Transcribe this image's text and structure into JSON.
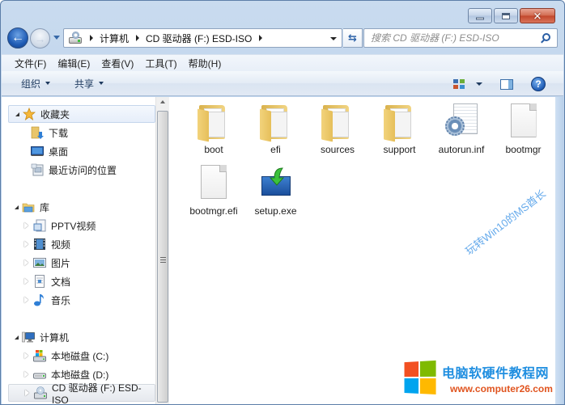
{
  "window": {
    "caption_buttons": {
      "minimize": "minimize",
      "maximize": "maximize",
      "close": "✕"
    }
  },
  "nav": {
    "back_glyph": "←",
    "forward_glyph": "→",
    "refresh_glyph": "⇆",
    "breadcrumb": [
      "计算机",
      "CD 驱动器 (F:) ESD-ISO"
    ],
    "search_placeholder": "搜索 CD 驱动器 (F:) ESD-ISO",
    "search_value": ""
  },
  "menubar": {
    "items": [
      "文件(F)",
      "编辑(E)",
      "查看(V)",
      "工具(T)",
      "帮助(H)"
    ]
  },
  "commandbar": {
    "organize_label": "组织",
    "share_label": "共享",
    "help_glyph": "?"
  },
  "sidebar": {
    "favorites": {
      "label": "收藏夹",
      "items": [
        {
          "label": "下载",
          "icon": "downloads-icon"
        },
        {
          "label": "桌面",
          "icon": "desktop-icon"
        },
        {
          "label": "最近访问的位置",
          "icon": "recent-places-icon"
        }
      ]
    },
    "libraries": {
      "label": "库",
      "items": [
        {
          "label": "PPTV视频",
          "icon": "pptv-library-icon"
        },
        {
          "label": "视频",
          "icon": "videos-icon"
        },
        {
          "label": "图片",
          "icon": "pictures-icon"
        },
        {
          "label": "文档",
          "icon": "documents-icon"
        },
        {
          "label": "音乐",
          "icon": "music-icon"
        }
      ]
    },
    "computer": {
      "label": "计算机",
      "items": [
        {
          "label": "本地磁盘 (C:)",
          "icon": "system-drive-icon"
        },
        {
          "label": "本地磁盘 (D:)",
          "icon": "local-drive-icon"
        },
        {
          "label": "CD 驱动器 (F:) ESD-ISO",
          "icon": "cd-drive-icon",
          "selected": true
        }
      ]
    }
  },
  "files": [
    {
      "name": "boot",
      "type": "folder"
    },
    {
      "name": "efi",
      "type": "folder"
    },
    {
      "name": "sources",
      "type": "folder"
    },
    {
      "name": "support",
      "type": "folder"
    },
    {
      "name": "autorun.inf",
      "type": "settings-file"
    },
    {
      "name": "bootmgr",
      "type": "file"
    },
    {
      "name": "bootmgr.efi",
      "type": "file"
    },
    {
      "name": "setup.exe",
      "type": "setup-exe"
    }
  ],
  "watermarks": {
    "diagonal": "玩转Win10的MS酋长",
    "site_name": "电脑软硬件教程网",
    "site_url": "www.computer26.com",
    "logo_colors": [
      "#f25022",
      "#7fba00",
      "#00a4ef",
      "#ffb900"
    ]
  },
  "colors": {
    "accent_blue": "#1f5cb5",
    "link_blue": "#1f8ee0",
    "url_orange": "#e0541f"
  }
}
